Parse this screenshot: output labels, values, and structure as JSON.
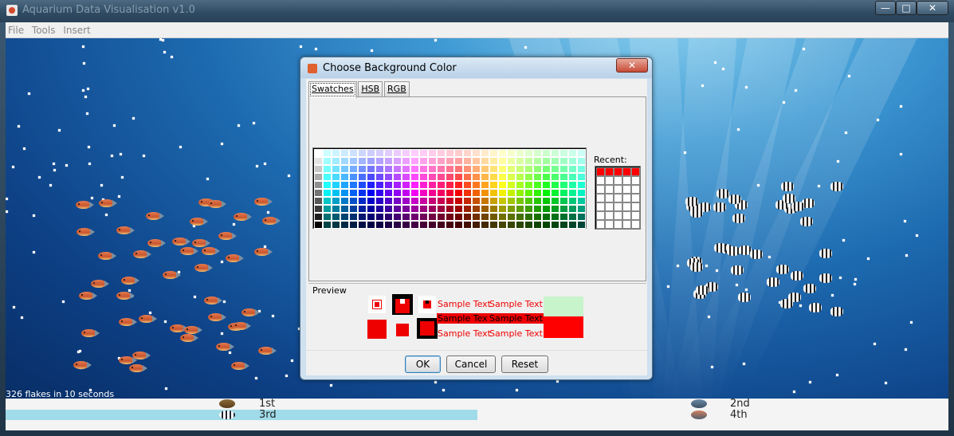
{
  "window": {
    "title": "Aquarium Data Visualisation v1.0",
    "controls": {
      "minimize": "—",
      "maximize": "□",
      "close": "✕"
    }
  },
  "menu": {
    "items": [
      "File",
      "Tools",
      "Insert"
    ]
  },
  "status": {
    "text": "326 flakes in 10 seconds"
  },
  "leaderboard": {
    "first": "1st",
    "second": "2nd",
    "third": "3rd",
    "fourth": "4th",
    "third_progress": 0.5
  },
  "dialog": {
    "title": "Choose Background Color",
    "close": "✕",
    "tabs": [
      {
        "label": "Swatches",
        "active": true
      },
      {
        "label": "HSB",
        "active": false
      },
      {
        "label": "RGB",
        "active": false
      }
    ],
    "recent_label": "Recent:",
    "preview_label": "Preview",
    "sample_text": "Sample Text",
    "selected_color": "#ff0000",
    "buttons": {
      "ok": "OK",
      "cancel": "Cancel",
      "reset": "Reset"
    }
  },
  "icons": {
    "app": "java-cup-icon",
    "dialog": "java-cup-icon"
  }
}
